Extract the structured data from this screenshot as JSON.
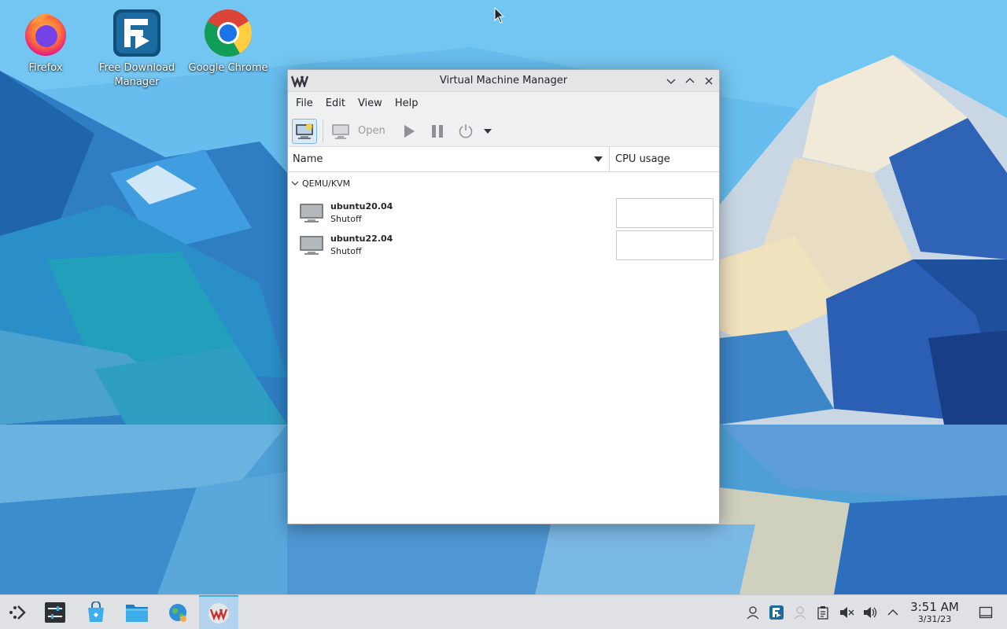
{
  "desktop": {
    "icons": [
      {
        "label": "Firefox",
        "icon": "firefox-icon"
      },
      {
        "label": "Free Download Manager",
        "icon": "free-download-manager-icon"
      },
      {
        "label": "Google Chrome",
        "icon": "google-chrome-icon"
      }
    ]
  },
  "window": {
    "title": "Virtual Machine Manager",
    "menu": [
      "File",
      "Edit",
      "View",
      "Help"
    ],
    "toolbar": {
      "open_label": "Open"
    },
    "columns": {
      "name": "Name",
      "cpu": "CPU usage"
    },
    "group": {
      "label": "QEMU/KVM",
      "vms": [
        {
          "name": "ubuntu20.04",
          "status": "Shutoff"
        },
        {
          "name": "ubuntu22.04",
          "status": "Shutoff"
        }
      ]
    }
  },
  "taskbar": {
    "clock": {
      "time": "3:51 AM",
      "date": "3/31/23"
    },
    "tasks": [
      "application-launcher-icon",
      "system-settings-icon",
      "discover-store-icon",
      "dolphin-files-icon",
      "browser-globe-icon",
      "virt-manager-icon"
    ],
    "tray": [
      "user-icon",
      "free-download-manager-tray-icon",
      "network-user-icon",
      "clipboard-icon",
      "volume-muted-icon",
      "volume-icon",
      "expand-tray-icon",
      "show-desktop-icon"
    ]
  },
  "colors": {
    "accent": "#3daee9",
    "window_bg": "#eff0f1",
    "taskbar_bg": "#dfe1e4"
  }
}
